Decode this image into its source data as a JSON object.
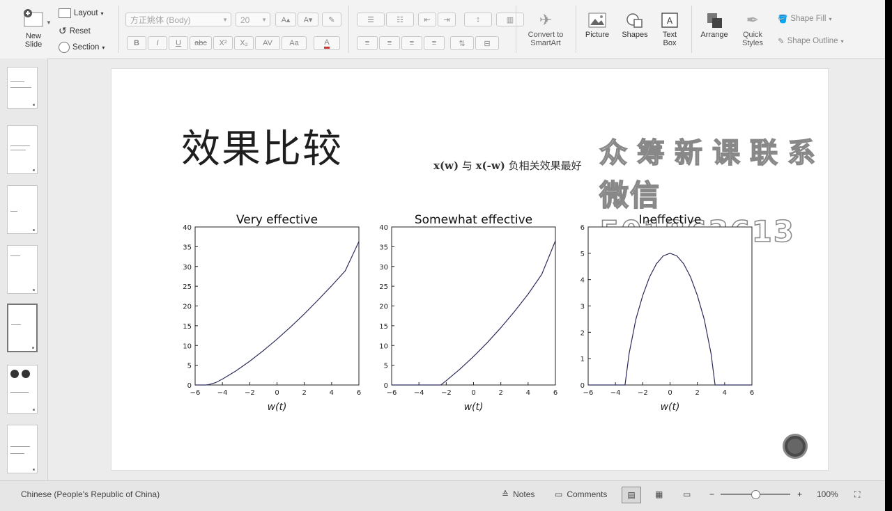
{
  "ribbon": {
    "new_slide": "New\nSlide",
    "layout": "Layout",
    "reset": "Reset",
    "section": "Section",
    "font_name": "方正姚体 (Body)",
    "font_size": "20",
    "format_buttons": [
      "B",
      "I",
      "U",
      "abc",
      "X²",
      "X₂",
      "AV",
      "A"
    ],
    "convert_smartart": "Convert to\nSmartArt",
    "picture": "Picture",
    "shapes": "Shapes",
    "text_box": "Text\nBox",
    "arrange": "Arrange",
    "quick_styles": "Quick\nStyles",
    "shape_fill": "Shape Fill",
    "shape_outline": "Shape Outline"
  },
  "slide": {
    "title": "效果比较",
    "subtitle_a": "x(w)",
    "subtitle_b": " 与 ",
    "subtitle_c": "x(-w)",
    "subtitle_d": " 负相关效果最好",
    "watermark_line1": "众筹新课联系",
    "watermark_line2": "微信501863613"
  },
  "chart_data": [
    {
      "type": "line",
      "title": "Very effective",
      "xlabel": "w(t)",
      "ylabel": "",
      "xlim": [
        -6,
        6
      ],
      "ylim": [
        0,
        40
      ],
      "xticks": [
        -6,
        -4,
        -2,
        0,
        2,
        4,
        6
      ],
      "yticks": [
        0,
        5,
        10,
        15,
        20,
        25,
        30,
        35,
        40
      ],
      "x": [
        -6,
        -5.2,
        -5,
        -4.5,
        -4,
        -3,
        -2,
        -1,
        0,
        1,
        2,
        3,
        4,
        5,
        6
      ],
      "y": [
        0,
        0,
        0.1,
        0.6,
        1.5,
        3.6,
        6.0,
        8.7,
        11.6,
        14.7,
        18.0,
        21.5,
        25.1,
        28.9,
        36.3
      ]
    },
    {
      "type": "line",
      "title": "Somewhat effective",
      "xlabel": "w(t)",
      "ylabel": "",
      "xlim": [
        -6,
        6
      ],
      "ylim": [
        0,
        40
      ],
      "xticks": [
        -6,
        -4,
        -2,
        0,
        2,
        4,
        6
      ],
      "yticks": [
        0,
        5,
        10,
        15,
        20,
        25,
        30,
        35,
        40
      ],
      "x": [
        -6,
        -2.4,
        -2,
        -1,
        0,
        1,
        2,
        3,
        4,
        5,
        6
      ],
      "y": [
        0,
        0,
        1.1,
        4.0,
        7.2,
        10.7,
        14.5,
        18.6,
        23.0,
        28.0,
        36.5
      ]
    },
    {
      "type": "line",
      "title": "Ineffective",
      "xlabel": "w(t)",
      "ylabel": "",
      "xlim": [
        -6,
        6
      ],
      "ylim": [
        0,
        6
      ],
      "xticks": [
        -6,
        -4,
        -2,
        0,
        2,
        4,
        6
      ],
      "yticks": [
        0,
        1,
        2,
        3,
        4,
        5,
        6
      ],
      "x": [
        -6,
        -3.3,
        -3,
        -2.5,
        -2,
        -1.5,
        -1,
        -0.5,
        0,
        0.5,
        1,
        1.5,
        2,
        2.5,
        3,
        3.3,
        6
      ],
      "y": [
        0,
        0,
        1.2,
        2.5,
        3.4,
        4.1,
        4.6,
        4.9,
        5.0,
        4.9,
        4.6,
        4.1,
        3.4,
        2.5,
        1.2,
        0,
        0
      ]
    }
  ],
  "status": {
    "language": "Chinese (People's Republic of China)",
    "notes": "Notes",
    "comments": "Comments",
    "zoom": "100%"
  }
}
